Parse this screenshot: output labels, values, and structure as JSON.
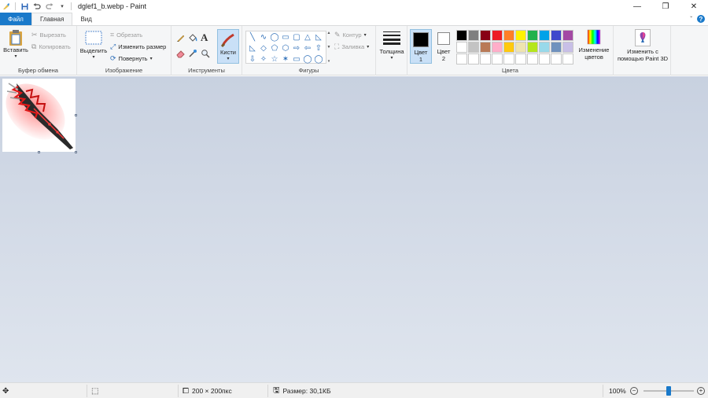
{
  "window": {
    "title": "dglef1_b.webp - Paint",
    "controls": {
      "minimize": "—",
      "maximize": "❐",
      "close": "✕"
    }
  },
  "tabs": {
    "file": "Файл",
    "home": "Главная",
    "view": "Вид"
  },
  "help": {
    "chevron": "ˇ",
    "question": "?"
  },
  "clipboard": {
    "paste": "Вставить",
    "cut": "Вырезать",
    "copy": "Копировать",
    "label": "Буфер обмена"
  },
  "image": {
    "select": "Выделить",
    "crop": "Обрезать",
    "resize": "Изменить размер",
    "rotate": "Повернуть",
    "label": "Изображение"
  },
  "tools": {
    "label": "Инструменты",
    "brushes": "Кисти"
  },
  "shapes": {
    "label": "Фигуры",
    "outline": "Контур",
    "fill": "Заливка",
    "glyphs": [
      "╲",
      "∿",
      "◯",
      "▭",
      "▢",
      "△",
      "◺",
      "◺",
      "◇",
      "⬠",
      "⬡",
      "⇨",
      "⇦",
      "⇧",
      "⇩",
      "✧",
      "☆",
      "✶",
      "▭",
      "◯",
      "◯"
    ]
  },
  "size": {
    "label": "Толщина"
  },
  "colors": {
    "color1": "Цвет 1",
    "color2": "Цвет 2",
    "color1_value": "#000000",
    "color2_value": "#ffffff",
    "edit": "Изменение цветов",
    "label": "Цвета",
    "palette": [
      "#000000",
      "#7f7f7f",
      "#880015",
      "#ed1c24",
      "#ff7f27",
      "#fff200",
      "#22b14c",
      "#00a2e8",
      "#3f48cc",
      "#a349a4",
      "#ffffff",
      "#c3c3c3",
      "#b97a57",
      "#ffaec9",
      "#ffc90e",
      "#efe4b0",
      "#b5e61d",
      "#99d9ea",
      "#7092be",
      "#c8bfe7",
      "#ffffff",
      "#ffffff",
      "#ffffff",
      "#ffffff",
      "#ffffff",
      "#ffffff",
      "#ffffff",
      "#ffffff",
      "#ffffff",
      "#ffffff"
    ]
  },
  "paint3d": {
    "label": "Изменить с помощью Paint 3D"
  },
  "status": {
    "dimensions": "200 × 200пкс",
    "file_size": "Размер: 30,1КБ",
    "zoom": "100%",
    "zoom_level": 0.5
  }
}
